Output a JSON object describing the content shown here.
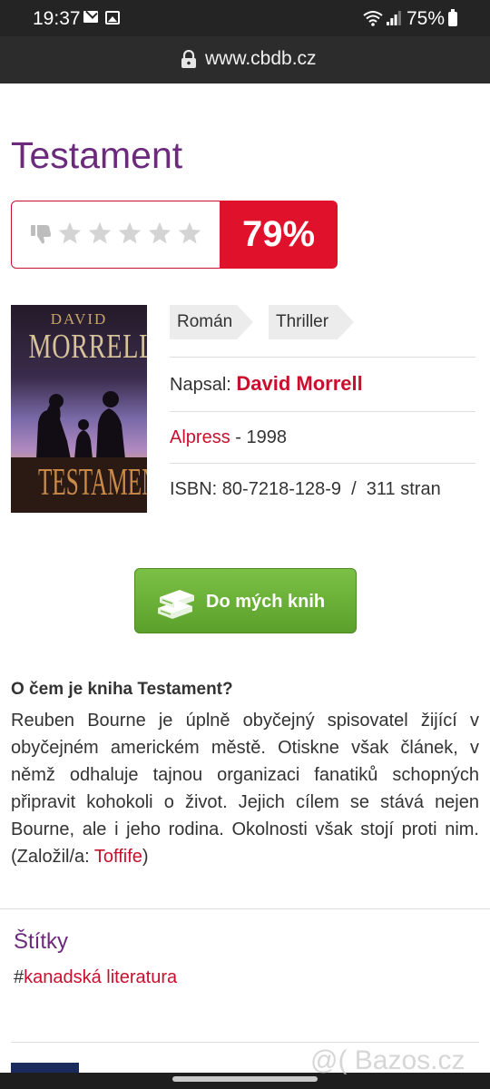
{
  "status_bar": {
    "time": "19:37",
    "battery": "75%",
    "icons": [
      "mail-icon",
      "gallery-icon",
      "wifi-icon",
      "signal-icon",
      "battery-icon"
    ]
  },
  "browser": {
    "url": "www.cbdb.cz",
    "lock_icon": "lock-icon"
  },
  "book": {
    "title": "Testament",
    "rating_percent": "79%",
    "rating_stars_filled": 0,
    "rating_stars_total": 5,
    "cover": {
      "author_first": "DAVID",
      "author_last": "MORRELL",
      "title": "TESTAMENT"
    },
    "genres": [
      "Román",
      "Thriller"
    ],
    "author_label": "Napsal:",
    "author": "David Morrell",
    "publisher": "Alpress",
    "year": "- 1998",
    "isbn": "ISBN: 80-7218-128-9  /  311 stran"
  },
  "add_button": {
    "label": "Do mých knih",
    "icon": "books-icon"
  },
  "about": {
    "heading": "O čem je kniha Testament?",
    "text": "Reuben Bourne je úplně obyčejný spisovatel žijící v obyčejném americkém městě. Otiskne však článek, v němž odhaluje tajnou organizaci fanatiků schopných připravit kohokoli o život. Jejich cílem se stává nejen Bourne, ale i jeho rodina. Okolnosti však stojí proti nim. (Založil/a: ",
    "founder": "Toffife",
    "closing": ")"
  },
  "tags": {
    "heading": "Štítky",
    "hash": "#",
    "items": [
      "kanadská literatura"
    ]
  },
  "watermark": "@( Bazos.cz",
  "colors": {
    "brand_purple": "#6b2a7c",
    "accent_red": "#e0112b",
    "button_green": "#6cb33f"
  }
}
